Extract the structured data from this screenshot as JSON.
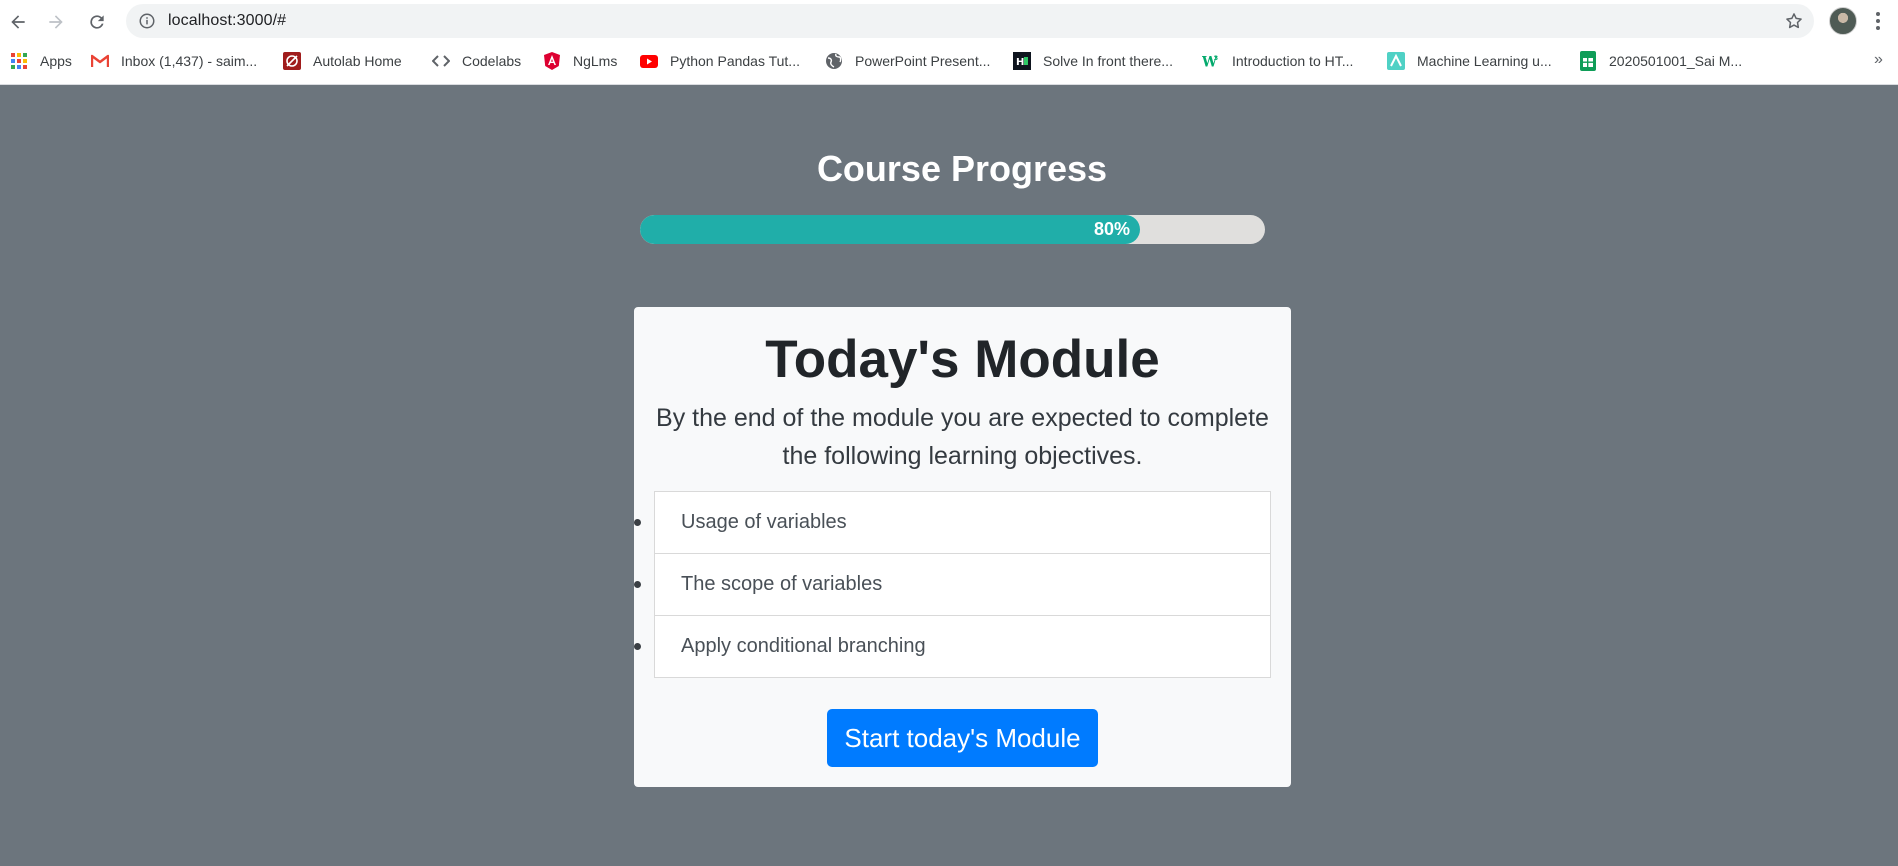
{
  "browser": {
    "url": "localhost:3000/#",
    "bookmarks": [
      {
        "label": "Apps",
        "icon": "apps-grid-icon"
      },
      {
        "label": "Inbox (1,437) - saim...",
        "icon": "gmail-icon"
      },
      {
        "label": "Autolab Home",
        "icon": "autolab-icon"
      },
      {
        "label": "Codelabs",
        "icon": "codelabs-icon"
      },
      {
        "label": "NgLms",
        "icon": "angular-icon"
      },
      {
        "label": "Python Pandas Tut...",
        "icon": "youtube-icon"
      },
      {
        "label": "PowerPoint Present...",
        "icon": "globe-icon"
      },
      {
        "label": "Solve In front there...",
        "icon": "hackerrank-icon"
      },
      {
        "label": "Introduction to HT...",
        "icon": "w3schools-icon"
      },
      {
        "label": "Machine Learning u...",
        "icon": "ml-icon"
      },
      {
        "label": "2020501001_Sai M...",
        "icon": "sheets-icon"
      }
    ],
    "more_label": "»"
  },
  "progress": {
    "title": "Course Progress",
    "label": "80%",
    "fraction": 0.8,
    "fill_color": "#20aea9",
    "track_color": "#e0dfdd"
  },
  "module": {
    "title": "Today's Module",
    "description": "By the end of the module you are expected to complete the following learning objectives.",
    "objectives": [
      "Usage of variables",
      "The scope of variables",
      "Apply conditional branching"
    ],
    "start_button": "Start today's Module",
    "button_color": "#007bff"
  },
  "colors": {
    "page_background": "#6c757d",
    "card_background": "#f8f9fa"
  }
}
